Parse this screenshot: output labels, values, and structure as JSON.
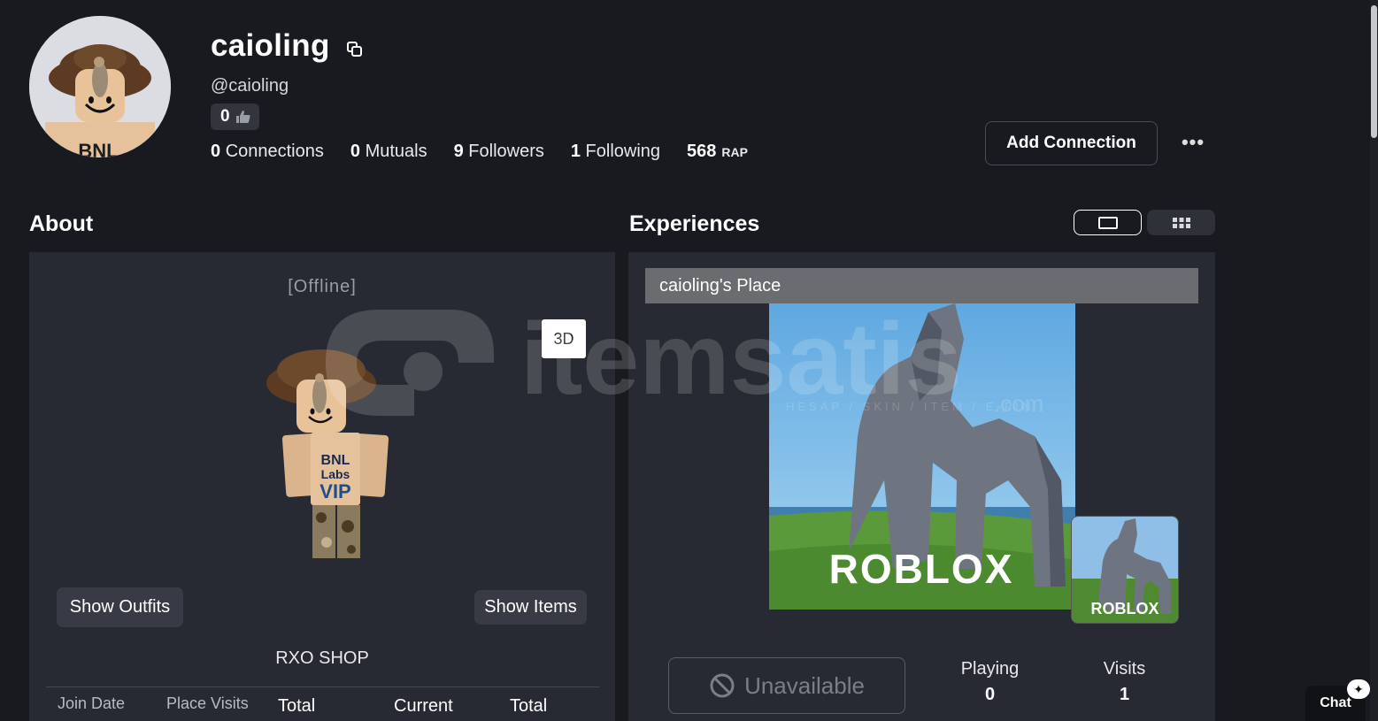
{
  "profile": {
    "display_name": "caioling",
    "username": "@caioling",
    "like_count": "0",
    "connections": {
      "count": "0",
      "label": "Connections"
    },
    "mutuals": {
      "count": "0",
      "label": "Mutuals"
    },
    "followers": {
      "count": "9",
      "label": "Followers"
    },
    "following": {
      "count": "1",
      "label": "Following"
    },
    "rap": {
      "count": "568",
      "label": "RAP"
    },
    "add_connection_label": "Add Connection",
    "more_label": "•••"
  },
  "about": {
    "title": "About",
    "presence": "[Offline]",
    "view_3d_label": "3D",
    "show_outfits_label": "Show Outfits",
    "show_items_label": "Show Items",
    "status_text": "RXO SHOP",
    "stat_headers": [
      "Join Date",
      "Place Visits",
      "Total",
      "Current",
      "Total"
    ],
    "avatar_shirt_text": [
      "BNL",
      "Labs",
      "VIP"
    ],
    "headshot_shirt_text": "BNL"
  },
  "experiences": {
    "title": "Experiences",
    "place_title": "caioling's Place",
    "thumbnail_logo": "ROBLOX",
    "unavailable_label": "Unavailable",
    "playing": {
      "label": "Playing",
      "value": "0"
    },
    "visits": {
      "label": "Visits",
      "value": "1"
    }
  },
  "watermark": {
    "text": "itemsatis",
    "subtext": "HESAP / SKIN / ITEM / E-PIN",
    "suffix": ".com"
  },
  "chat": {
    "label": "Chat",
    "badge": "✦"
  },
  "colors": {
    "background": "#191a1f",
    "panel": "#272a33",
    "pill": "#383b45",
    "place_bar": "#6b6c70"
  }
}
